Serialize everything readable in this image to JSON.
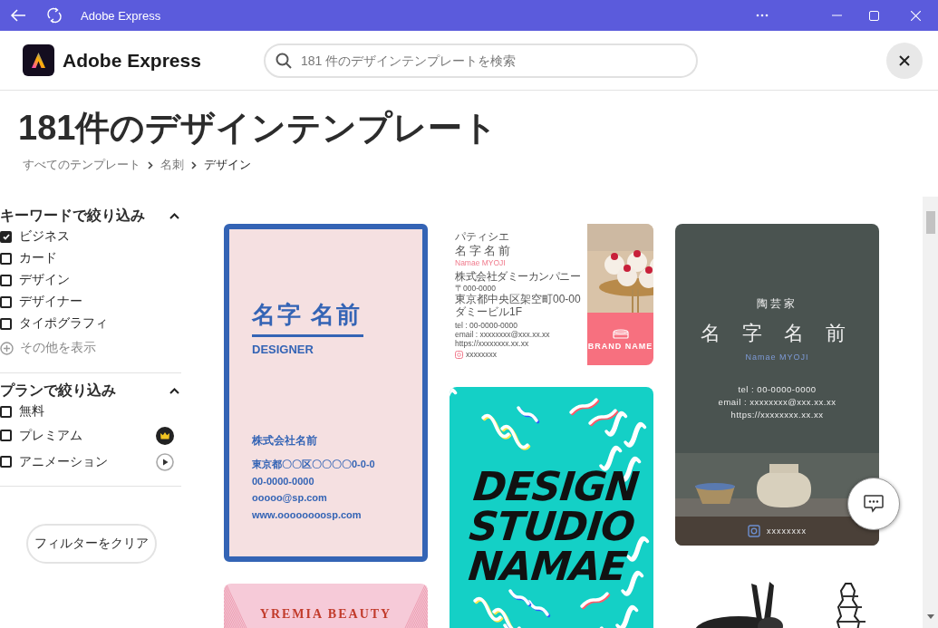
{
  "window": {
    "title": "Adobe Express"
  },
  "header": {
    "app_name": "Adobe Express",
    "search": {
      "placeholder": "181 件のデザインテンプレートを検索"
    }
  },
  "page_title": "181件のデザインテンプレート",
  "breadcrumb": [
    {
      "label": "すべてのテンプレート",
      "current": false
    },
    {
      "label": "名刺",
      "current": false
    },
    {
      "label": "デザイン",
      "current": true
    }
  ],
  "filters": [
    {
      "title": "キーワードで絞り込み",
      "expanded": true,
      "options": [
        {
          "label": "ビジネス",
          "checked": true
        },
        {
          "label": "カード",
          "checked": false
        },
        {
          "label": "デザイン",
          "checked": false
        },
        {
          "label": "デザイナー",
          "checked": false
        },
        {
          "label": "タイポグラフィ",
          "checked": false
        }
      ],
      "show_more": "その他を表示"
    },
    {
      "title": "プランで絞り込み",
      "expanded": true,
      "options": [
        {
          "label": "無料",
          "checked": false,
          "kind": "plain"
        },
        {
          "label": "プレミアム",
          "checked": false,
          "kind": "premium"
        },
        {
          "label": "アニメーション",
          "checked": false,
          "kind": "animation"
        }
      ]
    }
  ],
  "clear_button": "フィルターをクリア",
  "template_columns": [
    [
      {
        "kind": "framed",
        "name": "名字 名前",
        "title": "DESIGNER",
        "company": "株式会社名前",
        "lines": [
          "東京都〇〇区〇〇〇〇0-0-0",
          "00-0000-0000",
          "ooooo@sp.com",
          "www.oooooooosp.com"
        ]
      },
      {
        "kind": "banner",
        "name": "YREMIA BEAUTY"
      }
    ],
    [
      {
        "kind": "photo-split",
        "role": "パティシエ",
        "name": "名字名前",
        "romaji": "Namae MYOJI",
        "company": "株式会社ダミーカンパニー",
        "lines": [
          "〒000-0000",
          "東京都中央区架空町00-00ダミービル1F"
        ],
        "contacts": [
          "tel : 00-0000-0000",
          "email : xxxxxxxx@xxx.xx.xx",
          "https://xxxxxxxx.xx.xx"
        ],
        "handle": "xxxxxxxx",
        "brand": "BRAND NAME"
      },
      {
        "kind": "pattern",
        "name": "DESIGN STUDIO NAMAE"
      }
    ],
    [
      {
        "kind": "photo-dark",
        "role": "陶芸家",
        "name": "名 字 名 前",
        "romaji": "Namae MYOJI",
        "contacts": [
          "tel : 00-0000-0000",
          "email : xxxxxxxx@xxx.xx.xx",
          "https://xxxxxxxx.xx.xx"
        ],
        "handle": "xxxxxxxx"
      },
      {
        "kind": "illustration"
      }
    ]
  ]
}
